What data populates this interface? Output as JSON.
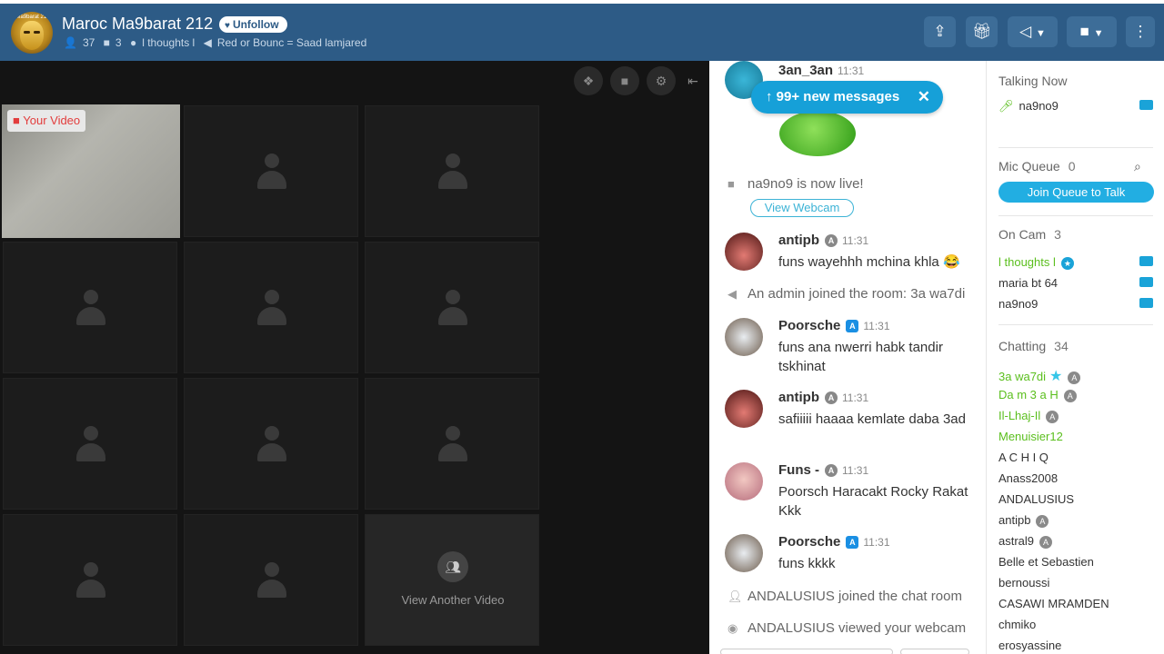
{
  "header": {
    "avatar_text": "Ma9barat 212",
    "room_title": "Maroc Ma9barat 212",
    "unfollow_label": "Unfollow",
    "users_count": "37",
    "cams_count": "3",
    "owner": "l thoughts l",
    "announcement": "Red or Bounc = Saad lamjared"
  },
  "video": {
    "your_video_label": "Your Video",
    "view_another_label": "View Another Video"
  },
  "chat": {
    "new_messages": "99+ new messages",
    "messages": [
      {
        "user": "3an_3an",
        "time": "11:31"
      },
      {
        "user": "antipb",
        "time": "11:31",
        "text": "funs wayehhh mchina khla 😂"
      },
      {
        "user": "Poorsche",
        "time": "11:31",
        "text": "funs ana nwerri habk tandir tskhinat"
      },
      {
        "user": "antipb",
        "time": "11:31",
        "text": "safiiiii haaaa kemlate daba 3ad"
      },
      {
        "user": "Funs -",
        "time": "11:31",
        "text": "Poorsch Haracakt Rocky Rakat Kkk"
      },
      {
        "user": "Poorsche",
        "time": "11:31",
        "text": "funs kkkk"
      }
    ],
    "system": {
      "live": "na9no9 is now live!",
      "view_webcam": "View Webcam",
      "admin_joined": "An admin joined the room: 3a wa7di",
      "joined": "ANDALUSIUS joined the chat room",
      "viewed": "ANDALUSIUS viewed your webcam"
    }
  },
  "sidebar": {
    "talking_now": "Talking Now",
    "talking_user": "na9no9",
    "mic_queue": "Mic Queue",
    "mic_queue_count": "0",
    "join_queue": "Join Queue to Talk",
    "on_cam": "On Cam",
    "on_cam_count": "3",
    "on_cam_users": [
      "l thoughts l",
      "maria bt 64",
      "na9no9"
    ],
    "chatting": "Chatting",
    "chatting_count": "34",
    "chatting_users": [
      "3a wa7di",
      "Da m 3 a H",
      "Il-Lhaj-Il",
      "Menuisier12",
      "A C H I Q",
      "Anass2008",
      "ANDALUSIUS",
      "antipb",
      "astral9",
      "Belle et Sebastien",
      "bernoussi",
      "CASAWI MRAMDEN",
      "chmiko",
      "erosyassine"
    ]
  },
  "colors": {
    "header_bg": "#2d5b86",
    "accent": "#1aa3d8",
    "green": "#5bbf1e"
  }
}
